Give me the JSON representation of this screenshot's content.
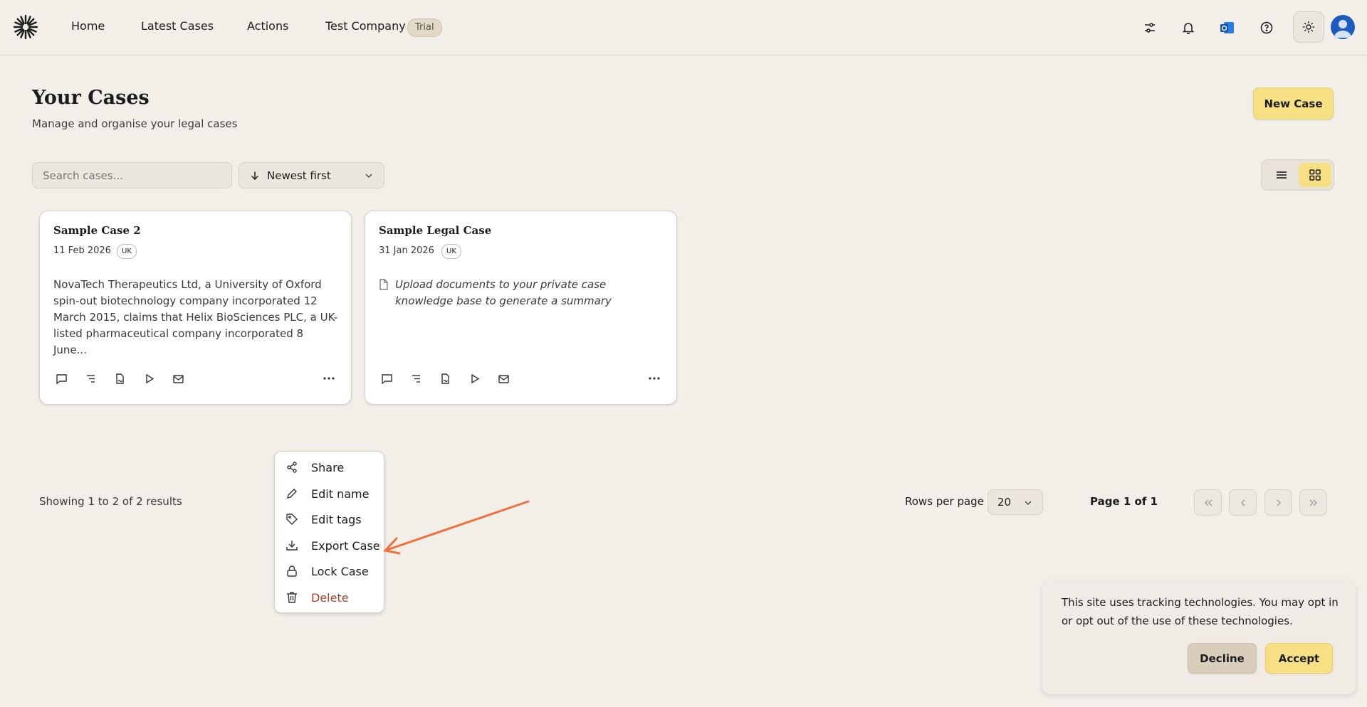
{
  "nav": {
    "items": [
      {
        "label": "Home"
      },
      {
        "label": "Latest Cases"
      },
      {
        "label": "Actions"
      },
      {
        "label": "Test Company"
      }
    ],
    "trial_badge": "Trial",
    "icons": [
      "filter-sliders-icon",
      "bell-icon",
      "outlook-icon",
      "help-icon",
      "sun-icon"
    ]
  },
  "header": {
    "title": "Your Cases",
    "subtitle": "Manage and organise your legal cases",
    "new_case": "New Case"
  },
  "toolbar": {
    "search_placeholder": "Search cases...",
    "sort_label": "Newest first"
  },
  "cards": [
    {
      "title": "Sample Case 2",
      "date": "11 Feb 2026",
      "badge": "UK",
      "body": "NovaTech Therapeutics Ltd, a University of Oxford spin-out biotechnology company incorporated 12 March 2015, claims that Helix BioSciences PLC, a UK-listed pharmaceutical company incorporated 8 June..."
    },
    {
      "title": "Sample Legal Case",
      "date": "31 Jan 2026",
      "badge": "UK",
      "body": "Upload documents to your private case knowledge base to generate a summary"
    }
  ],
  "menu": {
    "items": [
      {
        "label": "Share",
        "icon": "share-icon"
      },
      {
        "label": "Edit name",
        "icon": "pencil-icon"
      },
      {
        "label": "Edit tags",
        "icon": "tag-icon"
      },
      {
        "label": "Export Case",
        "icon": "download-icon"
      },
      {
        "label": "Lock Case",
        "icon": "lock-icon"
      },
      {
        "label": "Delete",
        "icon": "trash-icon",
        "color": "#a2452e"
      }
    ]
  },
  "pagination": {
    "showing": "Showing 1 to 2 of 2 results",
    "rows_label": "Rows per page",
    "rows_value": "20",
    "page_info": "Page 1 of 1"
  },
  "cookie": {
    "text": "This site uses tracking technologies. You may opt in or opt out of the use of these technologies.",
    "decline": "Decline",
    "accept": "Accept"
  },
  "colors": {
    "accent": "#f7df83",
    "background": "#f2efe9",
    "annotation_arrow": "#f07040",
    "danger": "#a2452e"
  }
}
